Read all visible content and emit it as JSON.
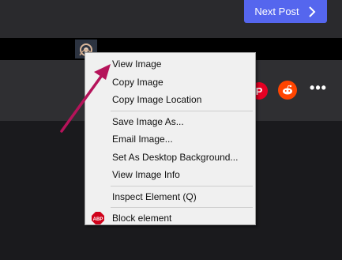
{
  "header": {
    "next_post_label": "Next Post"
  },
  "share": {
    "pinterest_glyph": "P"
  },
  "context_menu": {
    "items": [
      {
        "label": "View Image"
      },
      {
        "label": "Copy Image"
      },
      {
        "label": "Copy Image Location"
      },
      {
        "label": "Save Image As..."
      },
      {
        "label": "Email Image..."
      },
      {
        "label": "Set As Desktop Background..."
      },
      {
        "label": "View Image Info"
      },
      {
        "label": "Inspect Element (Q)"
      },
      {
        "label": "Block element"
      }
    ]
  },
  "colors": {
    "accent": "#5566ee",
    "arrow": "#b5135a",
    "menu_bg": "#f0f0f0",
    "pinterest": "#e60023",
    "reddit": "#ff4500",
    "abp": "#d0021b"
  },
  "icons": {
    "next_post": "chevron-right-icon",
    "pinterest": "pinterest-icon",
    "reddit": "reddit-icon",
    "more": "more-horizontal-icon",
    "block": "adblock-plus-icon"
  }
}
